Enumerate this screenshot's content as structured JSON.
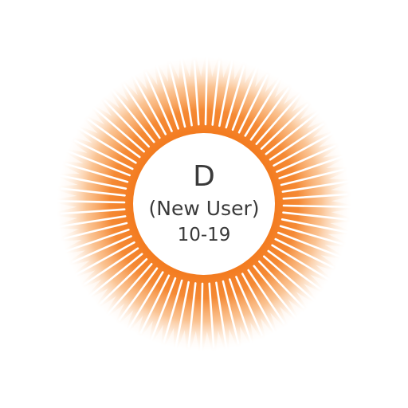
{
  "badge": {
    "grade": "D",
    "status": "(New User)",
    "range": "10-19"
  },
  "colors": {
    "accent": "#f37b1f",
    "accent_light": "#f9a860",
    "text": "#3a3a3a",
    "center_fill": "#ffffff"
  },
  "icon": "sunburst-badge-icon"
}
